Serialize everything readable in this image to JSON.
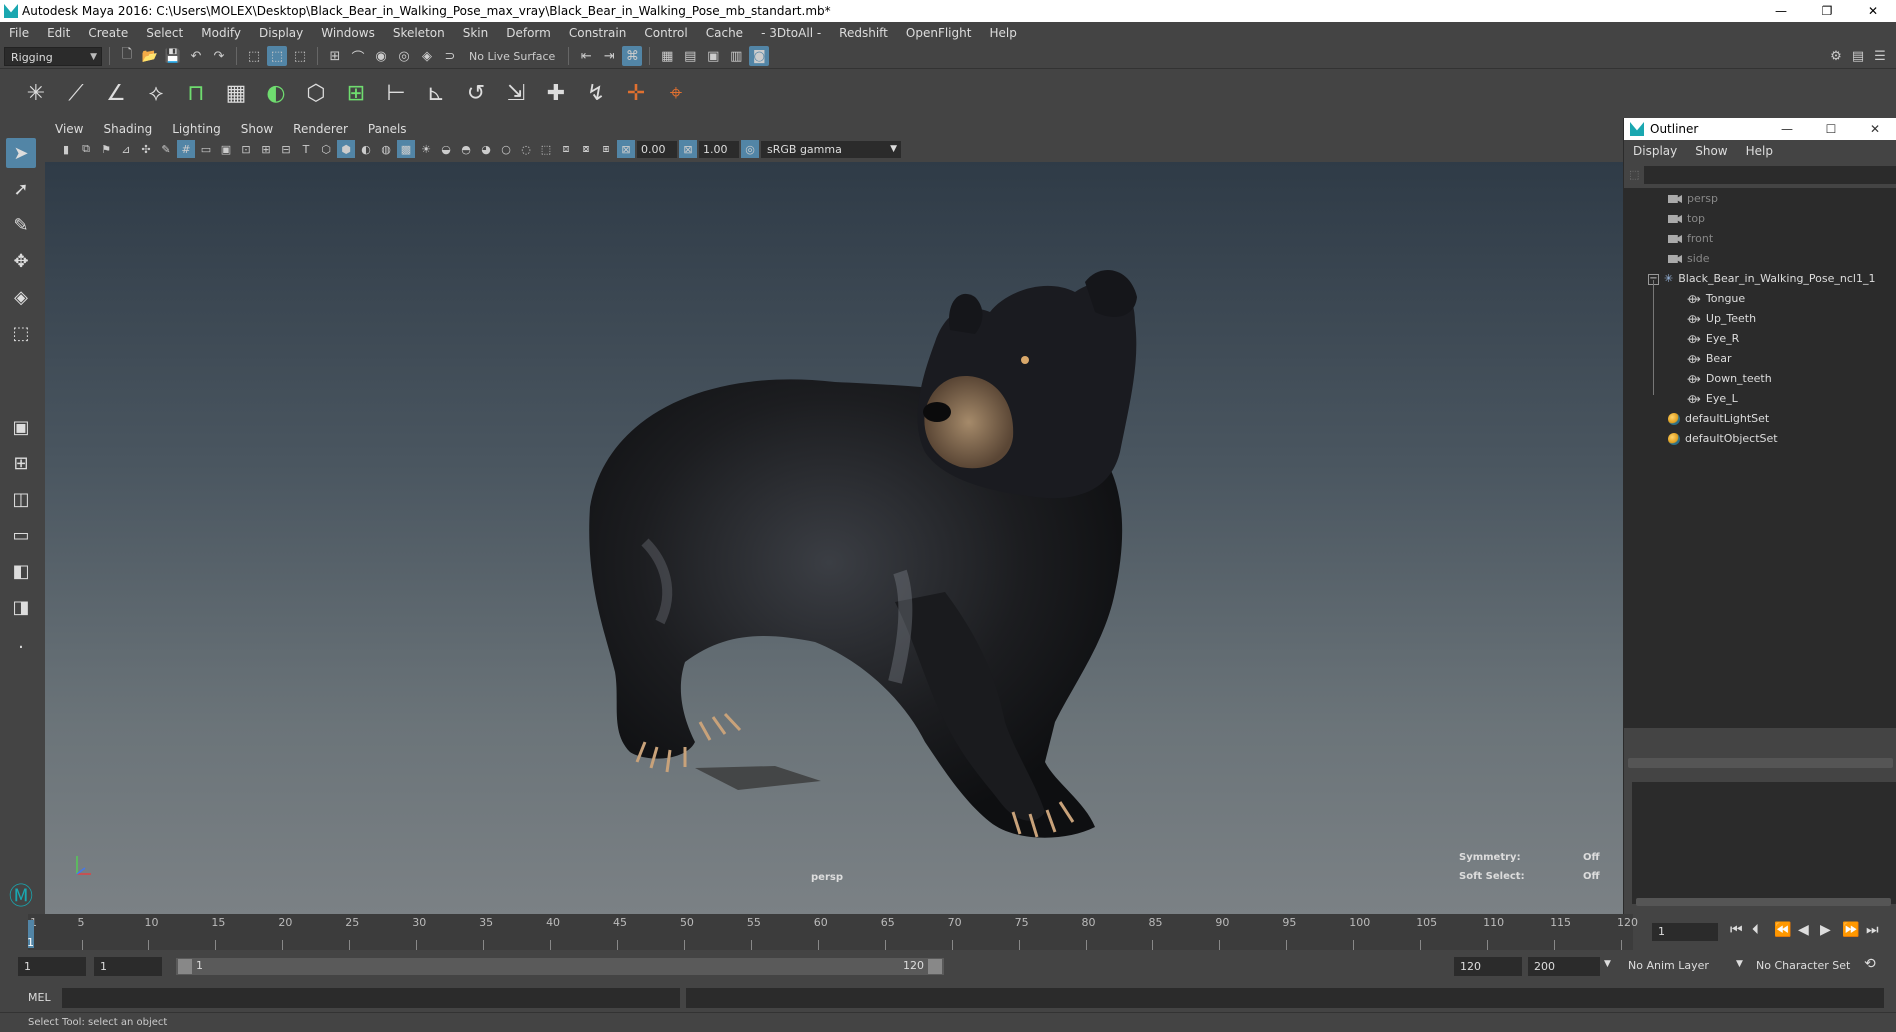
{
  "window": {
    "title": "Autodesk Maya 2016: C:\\Users\\MOLEX\\Desktop\\Black_Bear_in_Walking_Pose_max_vray\\Black_Bear_in_Walking_Pose_mb_standart.mb*",
    "minimize": "—",
    "restore": "❐",
    "close": "✕"
  },
  "menubar": [
    "File",
    "Edit",
    "Create",
    "Select",
    "Modify",
    "Display",
    "Windows",
    "Skeleton",
    "Skin",
    "Deform",
    "Constrain",
    "Control",
    "Cache",
    "- 3DtoAll -",
    "Redshift",
    "OpenFlight",
    "Help"
  ],
  "statusline": {
    "menuset": "Rigging",
    "live_surface": "No Live Surface"
  },
  "viewport": {
    "menus": [
      "View",
      "Shading",
      "Lighting",
      "Show",
      "Renderer",
      "Panels"
    ],
    "exposure": "0.00",
    "gamma": "1.00",
    "color_space": "sRGB gamma",
    "camera_label": "persp",
    "hud": {
      "symmetry_label": "Symmetry:",
      "symmetry_value": "Off",
      "soft_select_label": "Soft Select:",
      "soft_select_value": "Off"
    }
  },
  "outliner": {
    "title": "Outliner",
    "menus": [
      "Display",
      "Show",
      "Help"
    ],
    "cameras": [
      "persp",
      "top",
      "front",
      "side"
    ],
    "group": "Black_Bear_in_Walking_Pose_ncl1_1",
    "children": [
      "Tongue",
      "Up_Teeth",
      "Eye_R",
      "Bear",
      "Down_teeth",
      "Eye_L"
    ],
    "sets": [
      "defaultLightSet",
      "defaultObjectSet"
    ]
  },
  "timeline": {
    "ticks": [
      "5",
      "10",
      "15",
      "20",
      "25",
      "30",
      "35",
      "40",
      "45",
      "50",
      "55",
      "60",
      "65",
      "70",
      "75",
      "80",
      "85",
      "90",
      "95",
      "100",
      "105",
      "110",
      "115",
      "120"
    ],
    "start_tick": "1",
    "current_frame": "1",
    "frame_field": "1"
  },
  "range": {
    "start": "1",
    "anim_start": "1",
    "slider_start": "1",
    "slider_end": "120",
    "end": "120",
    "anim_end": "200",
    "anim_layer": "No Anim Layer",
    "character_set": "No Character Set"
  },
  "command": {
    "language": "MEL"
  },
  "help_line": "Select Tool: select an object",
  "colors": {
    "accent": "#5285a6",
    "panel": "#444444",
    "field": "#2b2b2b",
    "maya_teal": "#1aa7b0"
  }
}
